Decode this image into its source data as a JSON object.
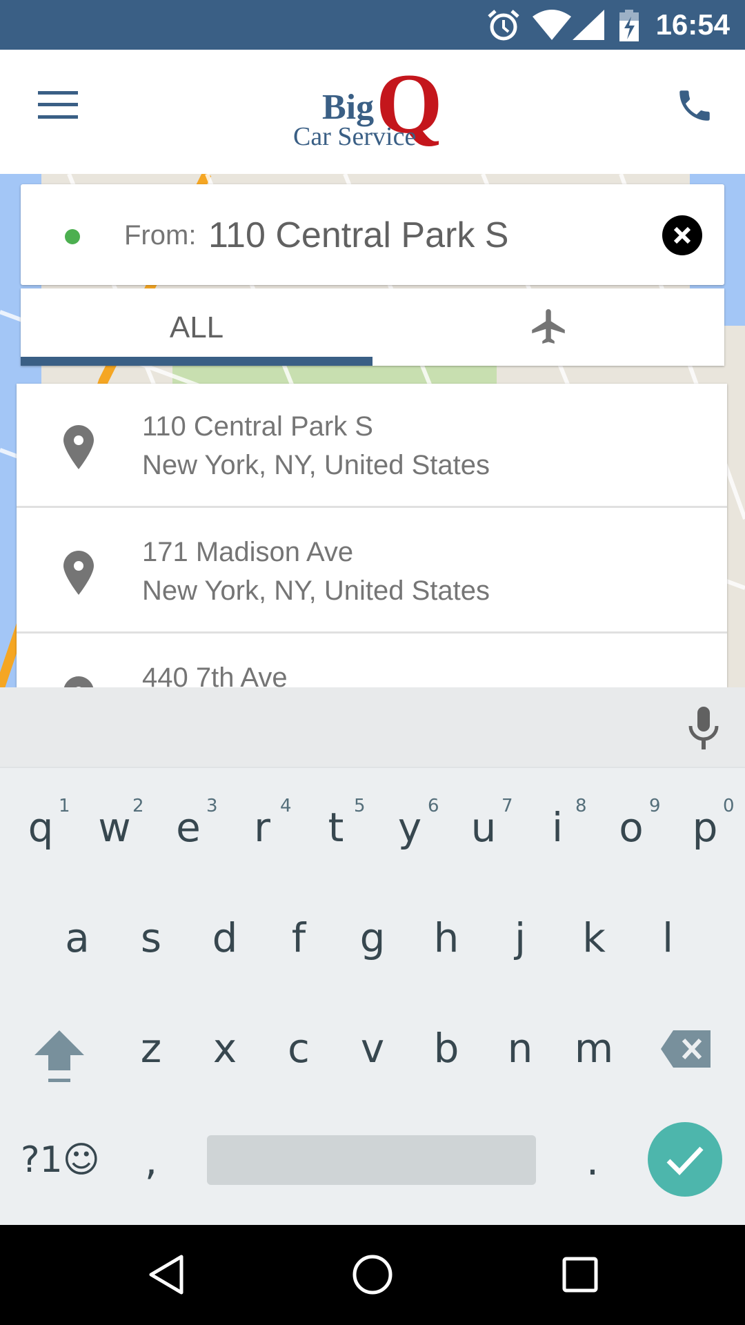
{
  "status_bar": {
    "time": "16:54",
    "icons": [
      "alarm-icon",
      "wifi-icon",
      "signal-icon",
      "battery-charging-icon"
    ]
  },
  "header": {
    "logo_text": [
      "Big",
      "Q",
      "Car Service"
    ],
    "brand_color": "#3a5f85",
    "logo_accent": "#c4161c"
  },
  "search": {
    "label": "From:",
    "value": "110 Central Park S",
    "dot_color": "#4caf50"
  },
  "tabs": [
    {
      "label": "ALL",
      "selected": true
    },
    {
      "icon": "airplane-icon",
      "selected": false
    }
  ],
  "results": [
    {
      "line1": "110 Central Park S",
      "line2": "New York, NY, United States"
    },
    {
      "line1": "171 Madison Ave",
      "line2": "New York, NY, United States"
    },
    {
      "line1": "440 7th Ave",
      "line2": ""
    }
  ],
  "keyboard": {
    "row1": [
      "q",
      "w",
      "e",
      "r",
      "t",
      "y",
      "u",
      "i",
      "o",
      "p"
    ],
    "row1_hints": [
      "1",
      "2",
      "3",
      "4",
      "5",
      "6",
      "7",
      "8",
      "9",
      "0"
    ],
    "row2": [
      "a",
      "s",
      "d",
      "f",
      "g",
      "h",
      "j",
      "k",
      "l"
    ],
    "row3": [
      "z",
      "x",
      "c",
      "v",
      "b",
      "n",
      "m"
    ],
    "symbols_label": "?1☺",
    "comma": ",",
    "period": ".",
    "enter_color": "#4db6ac"
  }
}
